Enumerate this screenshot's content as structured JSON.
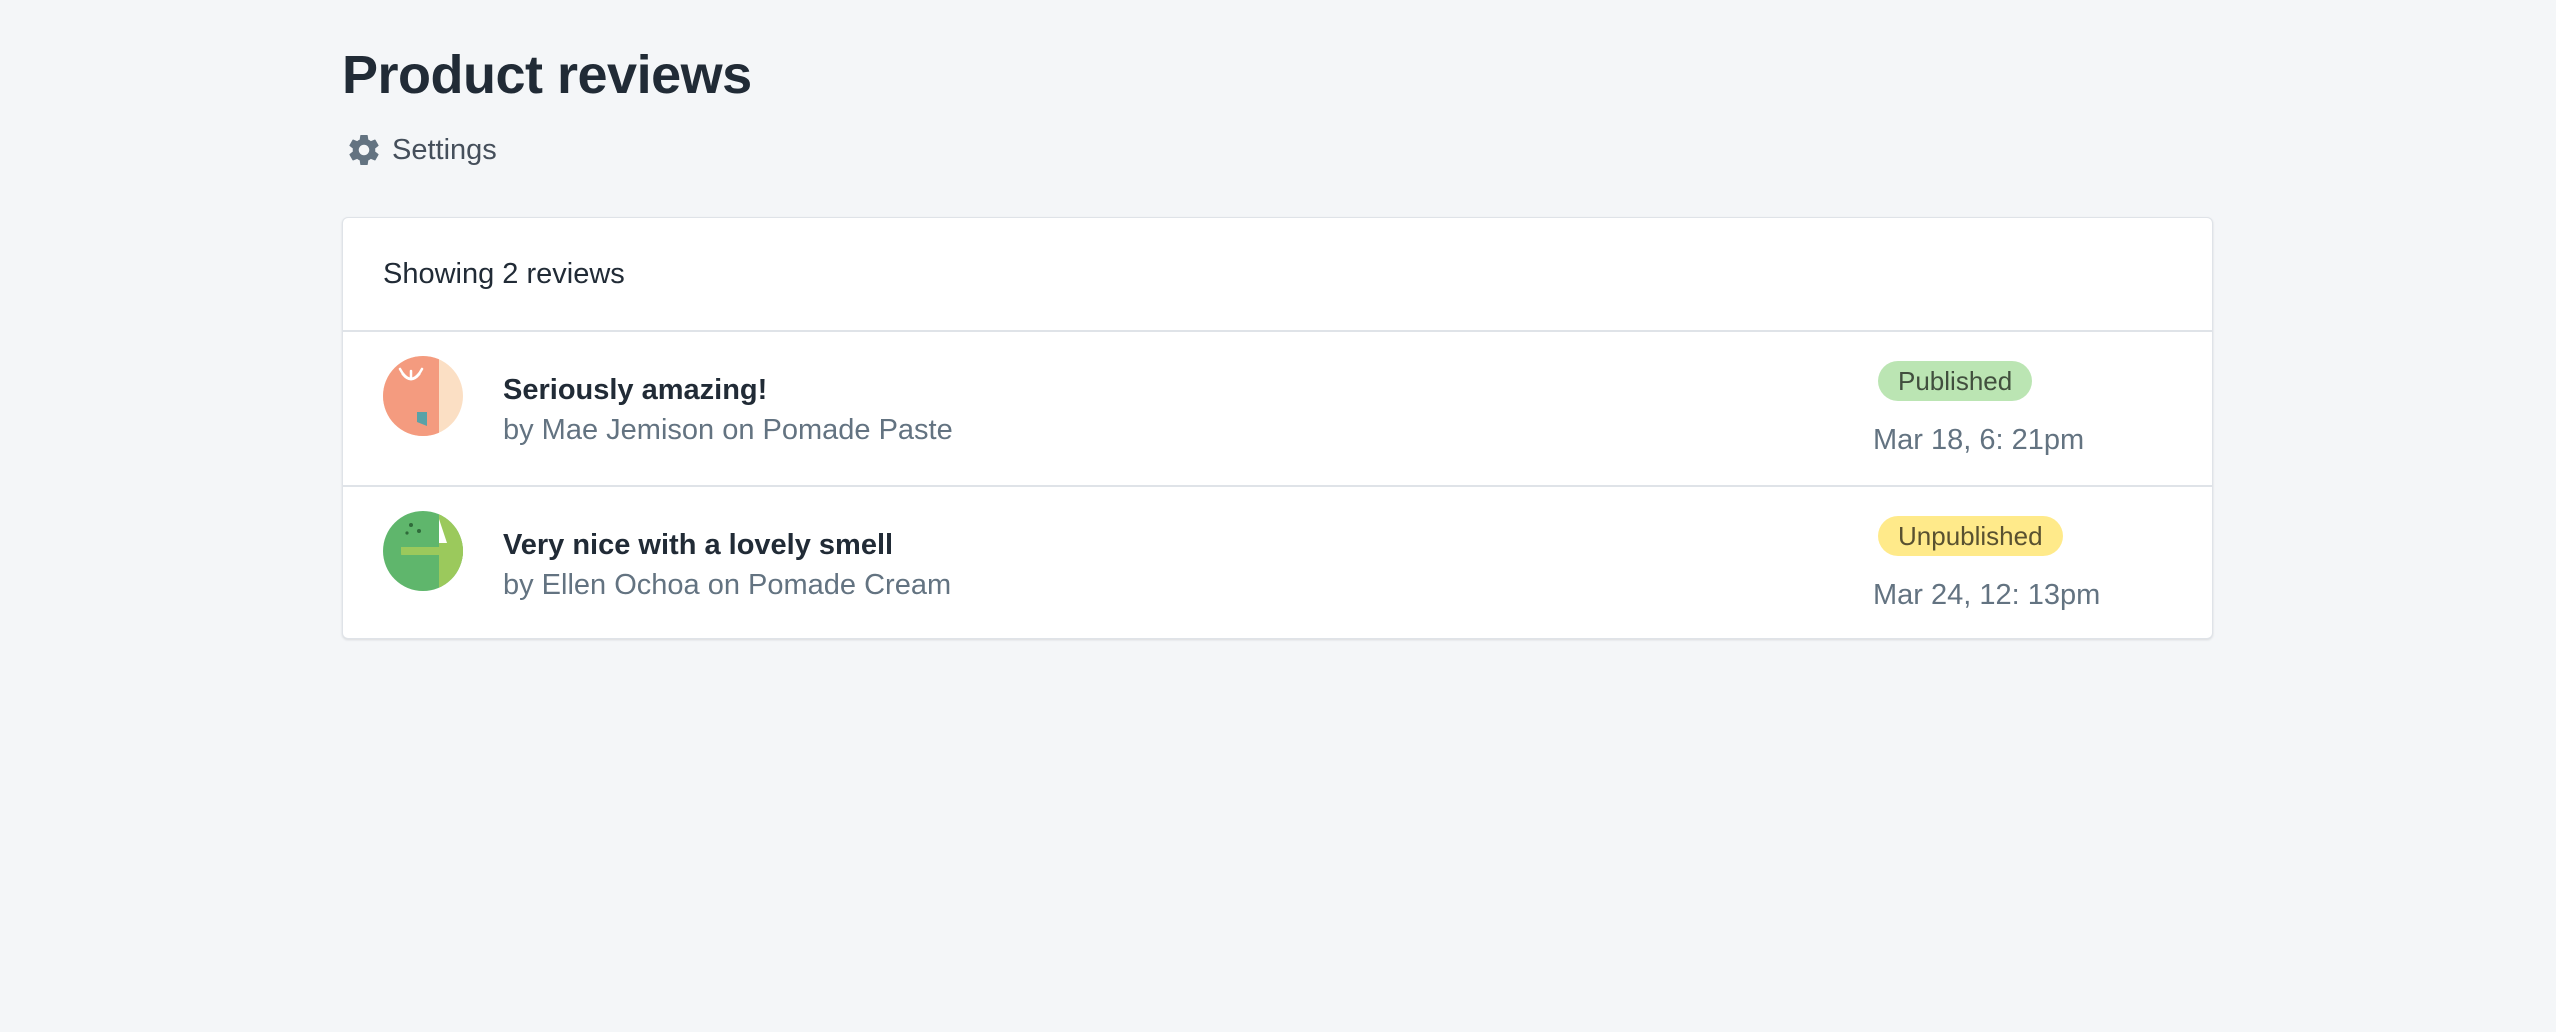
{
  "page": {
    "title": "Product reviews"
  },
  "actions": {
    "settings_label": "Settings",
    "settings_icon": "gear-icon"
  },
  "reviews_card": {
    "count_text": "Showing 2 reviews",
    "reviews": [
      {
        "title": "Seriously amazing!",
        "meta": "by Mae Jemison on Pomade Paste",
        "status": "Published",
        "status_color": "#bbe5b3",
        "date": "Mar 18, 6: 21pm",
        "avatar_icon": "avatar-illustration"
      },
      {
        "title": "Very nice with a lovely smell",
        "meta": "by Ellen Ochoa on Pomade Cream",
        "status": "Unpublished",
        "status_color": "#ffea8a",
        "date": "Mar 24, 12: 13pm",
        "avatar_icon": "avatar-illustration"
      }
    ]
  },
  "colors": {
    "background": "#f4f6f8",
    "text_primary": "#212b36",
    "text_subdued": "#637381",
    "border": "#dfe3e8"
  }
}
